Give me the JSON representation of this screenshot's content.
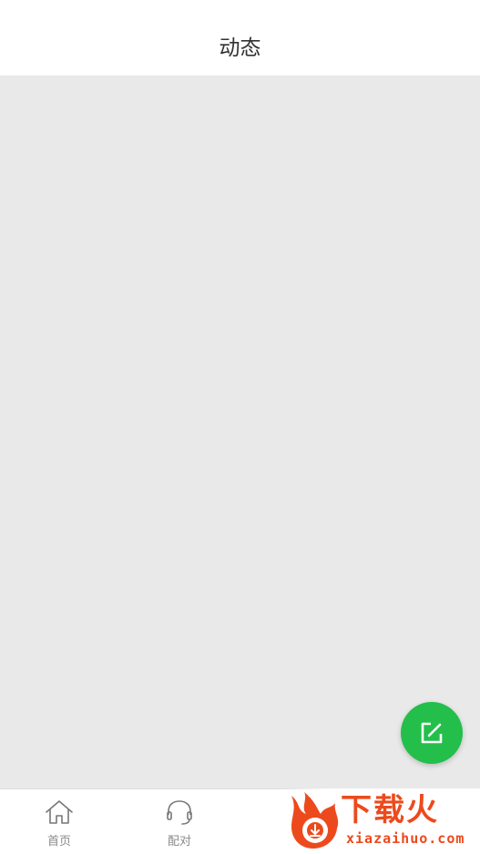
{
  "header": {
    "title": "动态"
  },
  "fab": {
    "icon": "edit-icon",
    "color": "#23bf4a"
  },
  "tab_bar": {
    "items": [
      {
        "label": "首页",
        "icon": "home-icon"
      },
      {
        "label": "配对",
        "icon": "headset-icon"
      }
    ]
  },
  "watermark": {
    "brand": "下载火",
    "domain": "xiazaihuo.com",
    "color": "#ec4a1d"
  }
}
